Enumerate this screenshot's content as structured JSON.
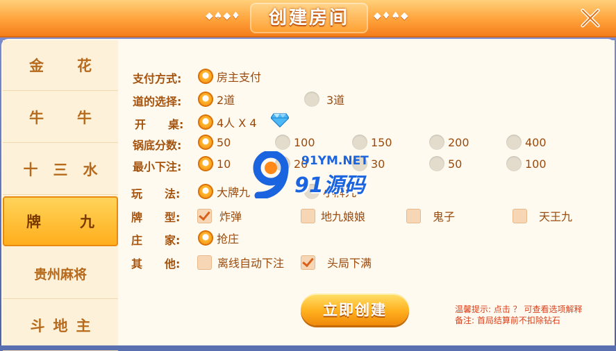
{
  "header": {
    "title": "创建房间",
    "left_ornament": "◆♠◆♦",
    "right_ornament": "◆♦♠◆"
  },
  "sidebar": {
    "items": [
      {
        "label": "金花",
        "active": false
      },
      {
        "label": "牛牛",
        "active": false
      },
      {
        "label": "十三水",
        "active": false
      },
      {
        "label": "牌九",
        "active": true
      },
      {
        "label": "贵州麻将",
        "active": false
      },
      {
        "label": "斗地主",
        "active": false
      }
    ]
  },
  "form": {
    "payment": {
      "label": "支付方式:",
      "options": [
        {
          "text": "房主支付",
          "selected": true
        }
      ]
    },
    "route": {
      "label": "道的选择:",
      "options": [
        {
          "text": "2道",
          "selected": true
        },
        {
          "text": "3道",
          "selected": false
        }
      ]
    },
    "table": {
      "label": "开　　桌:",
      "options": [
        {
          "text": "4人 X 4",
          "selected": true
        }
      ]
    },
    "base_score": {
      "label": "锅底分数:",
      "options": [
        {
          "text": "50",
          "selected": true
        },
        {
          "text": "100",
          "selected": false
        },
        {
          "text": "150",
          "selected": false
        },
        {
          "text": "200",
          "selected": false
        },
        {
          "text": "400",
          "selected": false
        }
      ]
    },
    "min_bet": {
      "label": "最小下注:",
      "options": [
        {
          "text": "10",
          "selected": true
        },
        {
          "text": "20",
          "selected": false
        },
        {
          "text": "30",
          "selected": false
        },
        {
          "text": "50",
          "selected": false
        },
        {
          "text": "100",
          "selected": false
        }
      ]
    },
    "play": {
      "label": "玩　　法:",
      "options": [
        {
          "text": "大牌九",
          "selected": true
        },
        {
          "text": "小牌九",
          "selected": false
        }
      ]
    },
    "card_type": {
      "label": "牌　　型:",
      "options": [
        {
          "text": "炸弹",
          "checked": true
        },
        {
          "text": "地九娘娘",
          "checked": false
        },
        {
          "text": "鬼子",
          "checked": false
        },
        {
          "text": "天王九",
          "checked": false
        }
      ]
    },
    "dealer": {
      "label": "庄　　家:",
      "options": [
        {
          "text": "抢庄",
          "selected": true
        }
      ]
    },
    "other": {
      "label": "其　　他:",
      "options": [
        {
          "text": "离线自动下注",
          "checked": false
        },
        {
          "text": "头局下满",
          "checked": true
        }
      ]
    }
  },
  "create_button": "立即创建",
  "hints": {
    "line1": "温馨提示: 点击 ？ 可查看选项解释",
    "line2": "备注: 首局结算前不扣除钻石"
  },
  "watermark": {
    "url_text": "91YM.NET",
    "brand_text": "91源码"
  },
  "colors": {
    "accent": "#f39a1e",
    "label": "#a4520c",
    "hint": "#d8401a"
  }
}
